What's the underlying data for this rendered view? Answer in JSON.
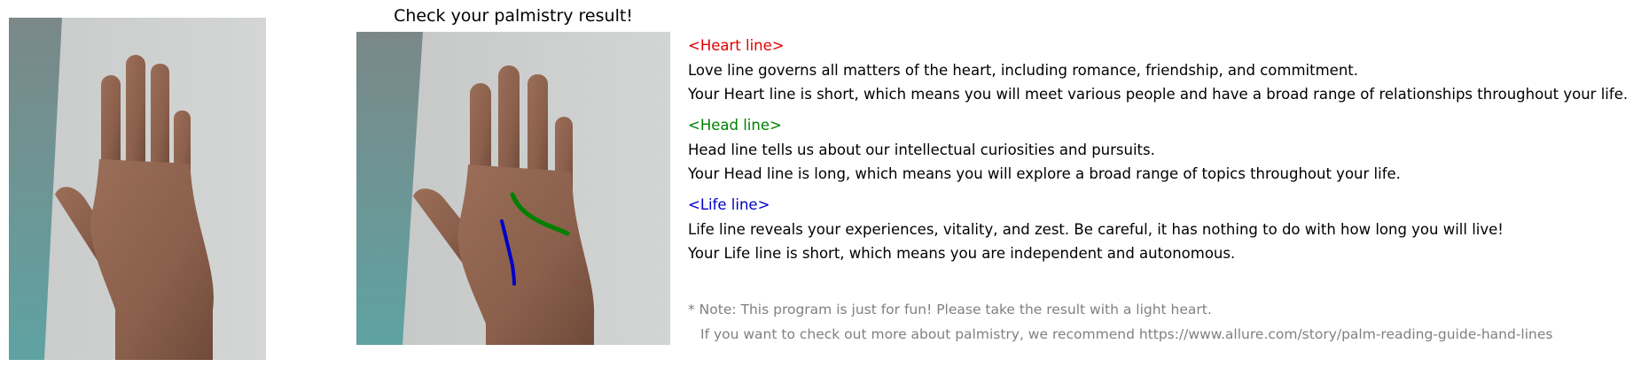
{
  "title": "Check your palmistry result!",
  "images": {
    "original": {
      "icon": "hand-photo"
    },
    "annotated": {
      "icon": "hand-photo-with-lines"
    }
  },
  "colors": {
    "heart": "#e00000",
    "head": "#008000",
    "life": "#0000c8",
    "note": "#808080"
  },
  "sections": {
    "heart": {
      "heading": "<Heart line>",
      "description": "Love line governs all matters of the heart, including romance, friendship, and commitment.",
      "result": "Your Heart line is short, which means you will meet various people and have a broad range of relationships throughout your life."
    },
    "head": {
      "heading": "<Head line>",
      "description": "Head line tells us about our intellectual curiosities and pursuits.",
      "result": "Your Head line is long, which means you will explore a broad range of topics throughout your life."
    },
    "life": {
      "heading": "<Life line>",
      "description": "Life line reveals your experiences, vitality, and zest. Be careful, it has nothing to do with how long you will live!",
      "result": "Your Life line is short, which means you are independent and autonomous."
    }
  },
  "note": {
    "line1": "* Note: This program is just for fun! Please take the result with a light heart.",
    "line2": "If you want to check out more about palmistry, we recommend https://www.allure.com/story/palm-reading-guide-hand-lines"
  }
}
